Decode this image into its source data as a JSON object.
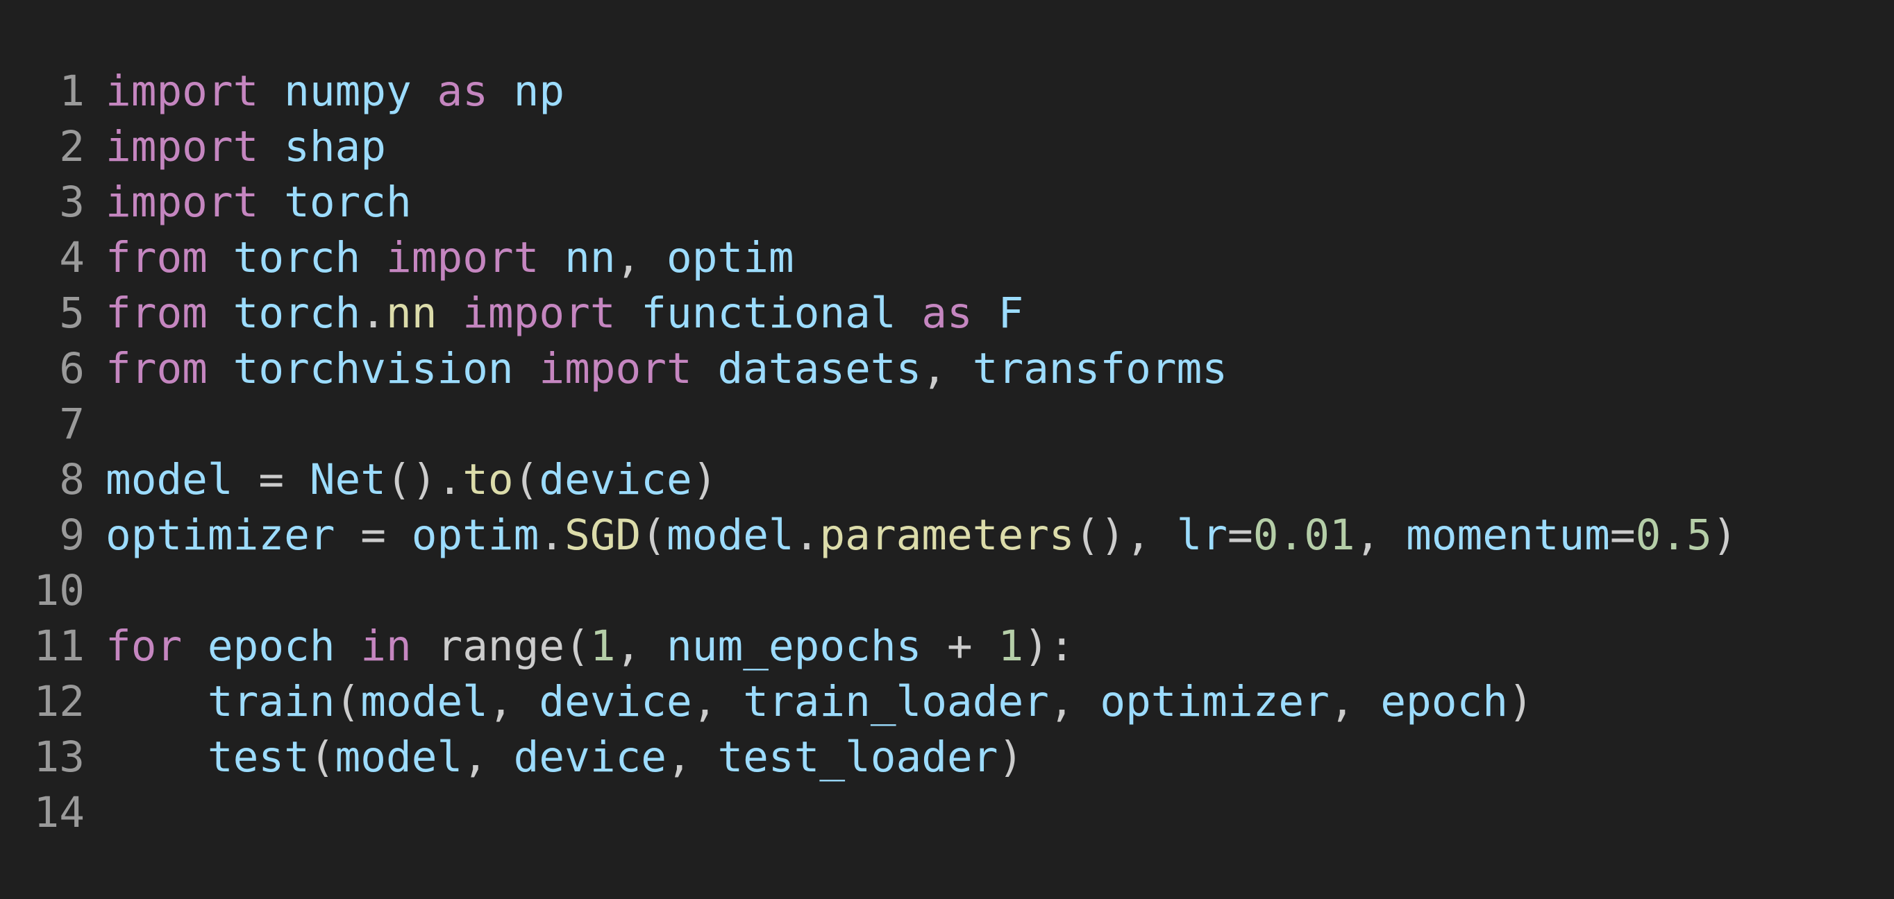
{
  "editor": {
    "lines": [
      {
        "no": "1",
        "tokens": [
          {
            "t": "import",
            "c": "kw"
          },
          {
            "t": " ",
            "c": "plain"
          },
          {
            "t": "numpy",
            "c": "mod"
          },
          {
            "t": " ",
            "c": "plain"
          },
          {
            "t": "as",
            "c": "kw"
          },
          {
            "t": " ",
            "c": "plain"
          },
          {
            "t": "np",
            "c": "mod"
          }
        ]
      },
      {
        "no": "2",
        "tokens": [
          {
            "t": "import",
            "c": "kw"
          },
          {
            "t": " ",
            "c": "plain"
          },
          {
            "t": "shap",
            "c": "mod"
          }
        ]
      },
      {
        "no": "3",
        "tokens": [
          {
            "t": "import",
            "c": "kw"
          },
          {
            "t": " ",
            "c": "plain"
          },
          {
            "t": "torch",
            "c": "mod"
          }
        ]
      },
      {
        "no": "4",
        "tokens": [
          {
            "t": "from",
            "c": "kw"
          },
          {
            "t": " ",
            "c": "plain"
          },
          {
            "t": "torch",
            "c": "mod"
          },
          {
            "t": " ",
            "c": "plain"
          },
          {
            "t": "import",
            "c": "kw"
          },
          {
            "t": " ",
            "c": "plain"
          },
          {
            "t": "nn",
            "c": "mod"
          },
          {
            "t": ", ",
            "c": "punc"
          },
          {
            "t": "optim",
            "c": "mod"
          }
        ]
      },
      {
        "no": "5",
        "tokens": [
          {
            "t": "from",
            "c": "kw"
          },
          {
            "t": " ",
            "c": "plain"
          },
          {
            "t": "torch",
            "c": "mod"
          },
          {
            "t": ".",
            "c": "punc"
          },
          {
            "t": "nn",
            "c": "fn"
          },
          {
            "t": " ",
            "c": "plain"
          },
          {
            "t": "import",
            "c": "kw"
          },
          {
            "t": " ",
            "c": "plain"
          },
          {
            "t": "functional",
            "c": "mod"
          },
          {
            "t": " ",
            "c": "plain"
          },
          {
            "t": "as",
            "c": "kw"
          },
          {
            "t": " ",
            "c": "plain"
          },
          {
            "t": "F",
            "c": "mod"
          }
        ]
      },
      {
        "no": "6",
        "tokens": [
          {
            "t": "from",
            "c": "kw"
          },
          {
            "t": " ",
            "c": "plain"
          },
          {
            "t": "torchvision",
            "c": "mod"
          },
          {
            "t": " ",
            "c": "plain"
          },
          {
            "t": "import",
            "c": "kw"
          },
          {
            "t": " ",
            "c": "plain"
          },
          {
            "t": "datasets",
            "c": "mod"
          },
          {
            "t": ", ",
            "c": "punc"
          },
          {
            "t": "transforms",
            "c": "mod"
          }
        ]
      },
      {
        "no": "7",
        "tokens": []
      },
      {
        "no": "8",
        "tokens": [
          {
            "t": "model",
            "c": "mod"
          },
          {
            "t": " = ",
            "c": "punc"
          },
          {
            "t": "Net",
            "c": "mod"
          },
          {
            "t": "().",
            "c": "punc"
          },
          {
            "t": "to",
            "c": "fn"
          },
          {
            "t": "(",
            "c": "punc"
          },
          {
            "t": "device",
            "c": "mod"
          },
          {
            "t": ")",
            "c": "punc"
          }
        ]
      },
      {
        "no": "9",
        "tokens": [
          {
            "t": "optimizer",
            "c": "mod"
          },
          {
            "t": " = ",
            "c": "punc"
          },
          {
            "t": "optim",
            "c": "mod"
          },
          {
            "t": ".",
            "c": "punc"
          },
          {
            "t": "SGD",
            "c": "fn"
          },
          {
            "t": "(",
            "c": "punc"
          },
          {
            "t": "model",
            "c": "mod"
          },
          {
            "t": ".",
            "c": "punc"
          },
          {
            "t": "parameters",
            "c": "fn"
          },
          {
            "t": "(), ",
            "c": "punc"
          },
          {
            "t": "lr",
            "c": "mod"
          },
          {
            "t": "=",
            "c": "punc"
          },
          {
            "t": "0.01",
            "c": "num"
          },
          {
            "t": ", ",
            "c": "punc"
          },
          {
            "t": "momentum",
            "c": "mod"
          },
          {
            "t": "=",
            "c": "punc"
          },
          {
            "t": "0.5",
            "c": "num"
          },
          {
            "t": ")",
            "c": "punc"
          }
        ]
      },
      {
        "no": "10",
        "tokens": []
      },
      {
        "no": "11",
        "tokens": [
          {
            "t": "for",
            "c": "kw"
          },
          {
            "t": " ",
            "c": "plain"
          },
          {
            "t": "epoch",
            "c": "mod"
          },
          {
            "t": " ",
            "c": "plain"
          },
          {
            "t": "in",
            "c": "kw"
          },
          {
            "t": " ",
            "c": "plain"
          },
          {
            "t": "range",
            "c": "plain"
          },
          {
            "t": "(",
            "c": "punc"
          },
          {
            "t": "1",
            "c": "num"
          },
          {
            "t": ", ",
            "c": "punc"
          },
          {
            "t": "num_epochs",
            "c": "mod"
          },
          {
            "t": " + ",
            "c": "punc"
          },
          {
            "t": "1",
            "c": "num"
          },
          {
            "t": "):",
            "c": "punc"
          }
        ]
      },
      {
        "no": "12",
        "tokens": [
          {
            "t": "    ",
            "c": "plain"
          },
          {
            "t": "train",
            "c": "mod"
          },
          {
            "t": "(",
            "c": "punc"
          },
          {
            "t": "model",
            "c": "mod"
          },
          {
            "t": ", ",
            "c": "punc"
          },
          {
            "t": "device",
            "c": "mod"
          },
          {
            "t": ", ",
            "c": "punc"
          },
          {
            "t": "train_loader",
            "c": "mod"
          },
          {
            "t": ", ",
            "c": "punc"
          },
          {
            "t": "optimizer",
            "c": "mod"
          },
          {
            "t": ", ",
            "c": "punc"
          },
          {
            "t": "epoch",
            "c": "mod"
          },
          {
            "t": ")",
            "c": "punc"
          }
        ]
      },
      {
        "no": "13",
        "tokens": [
          {
            "t": "    ",
            "c": "plain"
          },
          {
            "t": "test",
            "c": "mod"
          },
          {
            "t": "(",
            "c": "punc"
          },
          {
            "t": "model",
            "c": "mod"
          },
          {
            "t": ", ",
            "c": "punc"
          },
          {
            "t": "device",
            "c": "mod"
          },
          {
            "t": ", ",
            "c": "punc"
          },
          {
            "t": "test_loader",
            "c": "mod"
          },
          {
            "t": ")",
            "c": "punc"
          }
        ]
      },
      {
        "no": "14",
        "tokens": []
      }
    ]
  },
  "colors": {
    "background": "#1f1f1f",
    "line_number": "#9a9a9a",
    "keyword": "#c586c0",
    "identifier": "#9cdcfe",
    "function": "#dcdcaa",
    "number": "#b5cea8",
    "punctuation": "#cccccc"
  }
}
